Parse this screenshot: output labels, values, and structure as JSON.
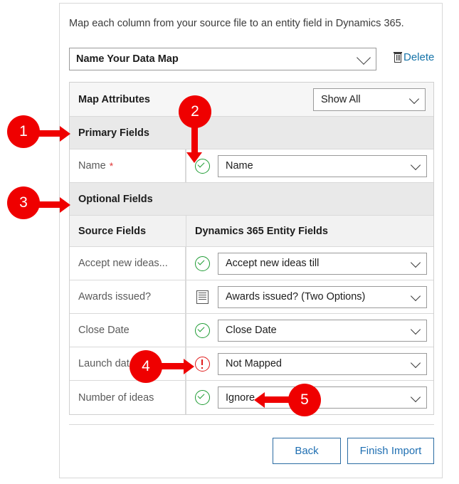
{
  "panel": {
    "intro_text": "Map each column from your source file to an entity field in Dynamics 365."
  },
  "map_name": {
    "value": "Name Your Data Map",
    "chevron_icon": "chevron-down-icon",
    "delete_label": "Delete",
    "delete_icon": "trash-icon"
  },
  "table": {
    "attributes_row": {
      "label": "Map Attributes",
      "filter_value": "Show All",
      "filter_chevron_icon": "chevron-down-icon"
    },
    "primary_group_label": "Primary Fields",
    "optional_group_label": "Optional Fields",
    "column_headers": {
      "source": "Source Fields",
      "target": "Dynamics 365 Entity Fields"
    },
    "primary_rows": [
      {
        "source": "Name",
        "required_marker": "*",
        "status_icon": "check-circle-icon",
        "status": "mapped",
        "target": "Name"
      }
    ],
    "optional_rows": [
      {
        "source": "Accept new ideas...",
        "status_icon": "check-circle-icon",
        "status": "mapped",
        "target": "Accept new ideas till"
      },
      {
        "source": "Awards issued?",
        "status_icon": "list-document-icon",
        "status": "option-set",
        "target": "Awards issued? (Two Options)"
      },
      {
        "source": "Close Date",
        "status_icon": "check-circle-icon",
        "status": "mapped",
        "target": "Close Date"
      },
      {
        "source": "Launch date",
        "status_icon": "error-circle-icon",
        "status": "not-mapped",
        "target": "Not Mapped"
      },
      {
        "source": "Number of ideas",
        "status_icon": "check-circle-icon",
        "status": "mapped",
        "target": "Ignore"
      }
    ]
  },
  "footer": {
    "back_label": "Back",
    "finish_label": "Finish Import"
  },
  "callouts": [
    {
      "number": "1"
    },
    {
      "number": "2"
    },
    {
      "number": "3"
    },
    {
      "number": "4"
    },
    {
      "number": "5"
    }
  ],
  "colors": {
    "callout_red": "#ef0000",
    "link_blue": "#1573a8",
    "button_blue": "#1f6fb2",
    "success_green": "#1d9b32",
    "error_red": "#e01b1b"
  }
}
